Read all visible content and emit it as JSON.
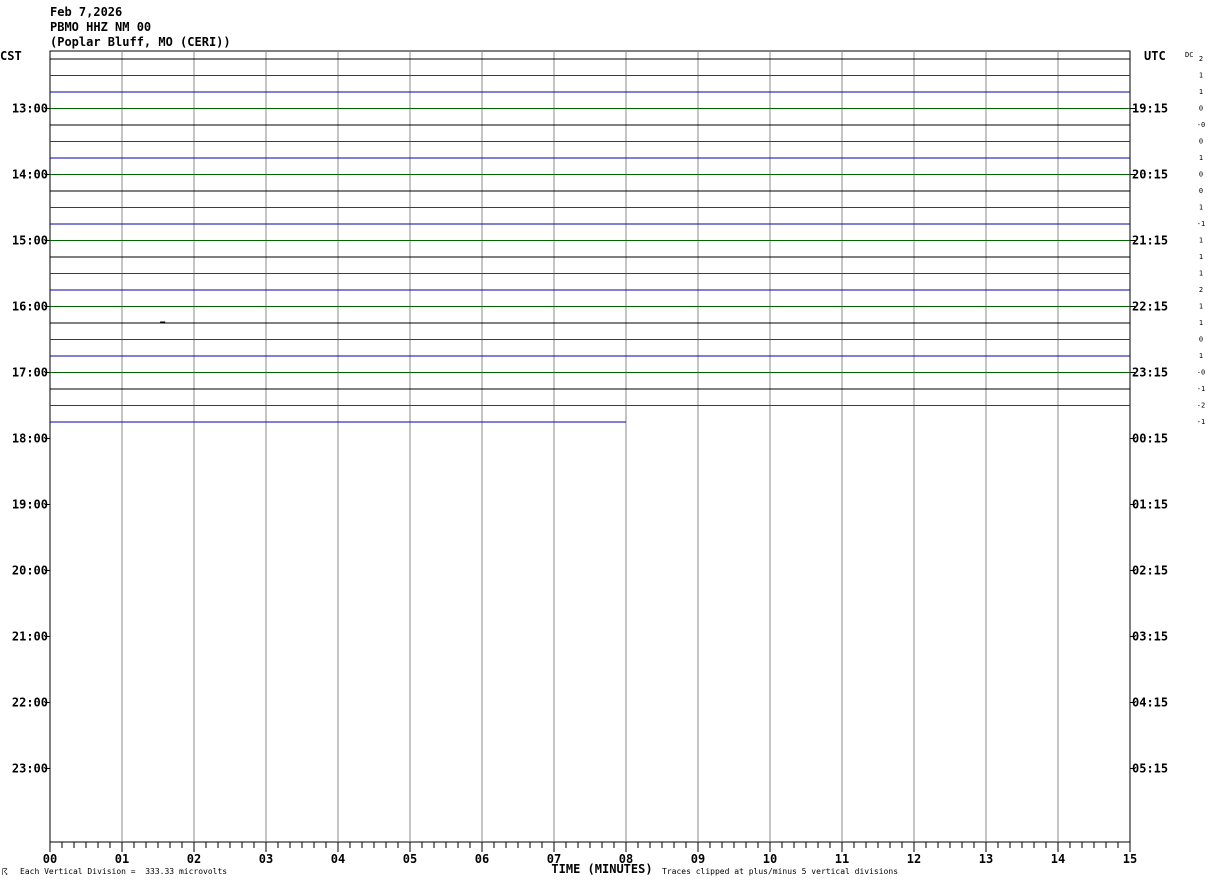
{
  "header": {
    "date": "Feb 7,2026",
    "station": "PBMO HHZ NM 00",
    "location": "(Poplar Bluff, MO (CERI))"
  },
  "chart_data": {
    "type": "line",
    "left_axis_label": "CST",
    "right_axis_label": "UTC",
    "dc_label": "DC",
    "xlabel": "TIME (MINUTES)",
    "xlim": [
      0,
      15
    ],
    "x_ticks": [
      "00",
      "01",
      "02",
      "03",
      "04",
      "05",
      "06",
      "07",
      "08",
      "09",
      "10",
      "11",
      "12",
      "13",
      "14",
      "15"
    ],
    "trace_minutes_per_line": 15,
    "hour_labels_left": [
      "13:00",
      "14:00",
      "15:00",
      "16:00",
      "17:00",
      "18:00",
      "19:00",
      "20:00",
      "21:00",
      "22:00",
      "23:00"
    ],
    "hour_labels_right": [
      "19:15",
      "20:15",
      "21:15",
      "22:15",
      "23:15",
      "00:15",
      "01:15",
      "02:15",
      "03:15",
      "04:15",
      "05:15"
    ],
    "trace_colors": [
      "#000000",
      "#cc0000",
      "#0000aa",
      "#006600"
    ],
    "traces": [
      {
        "start": "12:15",
        "dc": "2",
        "end_minute": 15
      },
      {
        "start": "12:30",
        "dc": "1",
        "end_minute": 15
      },
      {
        "start": "12:45",
        "dc": "1",
        "end_minute": 15
      },
      {
        "start": "13:00",
        "dc": "0",
        "end_minute": 15
      },
      {
        "start": "13:15",
        "dc": "-0",
        "end_minute": 15
      },
      {
        "start": "13:30",
        "dc": "0",
        "end_minute": 15
      },
      {
        "start": "13:45",
        "dc": "1",
        "end_minute": 15
      },
      {
        "start": "14:00",
        "dc": "0",
        "end_minute": 15
      },
      {
        "start": "14:15",
        "dc": "0",
        "end_minute": 15
      },
      {
        "start": "14:30",
        "dc": "1",
        "end_minute": 15
      },
      {
        "start": "14:45",
        "dc": "-1",
        "end_minute": 15
      },
      {
        "start": "15:00",
        "dc": "1",
        "end_minute": 15
      },
      {
        "start": "15:15",
        "dc": "1",
        "end_minute": 15
      },
      {
        "start": "15:30",
        "dc": "1",
        "end_minute": 15
      },
      {
        "start": "15:45",
        "dc": "2",
        "end_minute": 15
      },
      {
        "start": "16:00",
        "dc": "1",
        "end_minute": 15
      },
      {
        "start": "16:15",
        "dc": "1",
        "end_minute": 15
      },
      {
        "start": "16:30",
        "dc": "0",
        "end_minute": 15
      },
      {
        "start": "16:45",
        "dc": "1",
        "end_minute": 15
      },
      {
        "start": "17:00",
        "dc": "-0",
        "end_minute": 15
      },
      {
        "start": "17:15",
        "dc": "-1",
        "end_minute": 15
      },
      {
        "start": "17:30",
        "dc": "-2",
        "end_minute": 15
      },
      {
        "start": "17:45",
        "dc": "-1",
        "end_minute": 8
      }
    ],
    "grid": true
  },
  "footer": {
    "scale_note": "Each Vertical Division =  333.33 microvolts",
    "clip_note": "Traces clipped at plus/minus 5 vertical divisions",
    "corner_mark": "☈"
  }
}
